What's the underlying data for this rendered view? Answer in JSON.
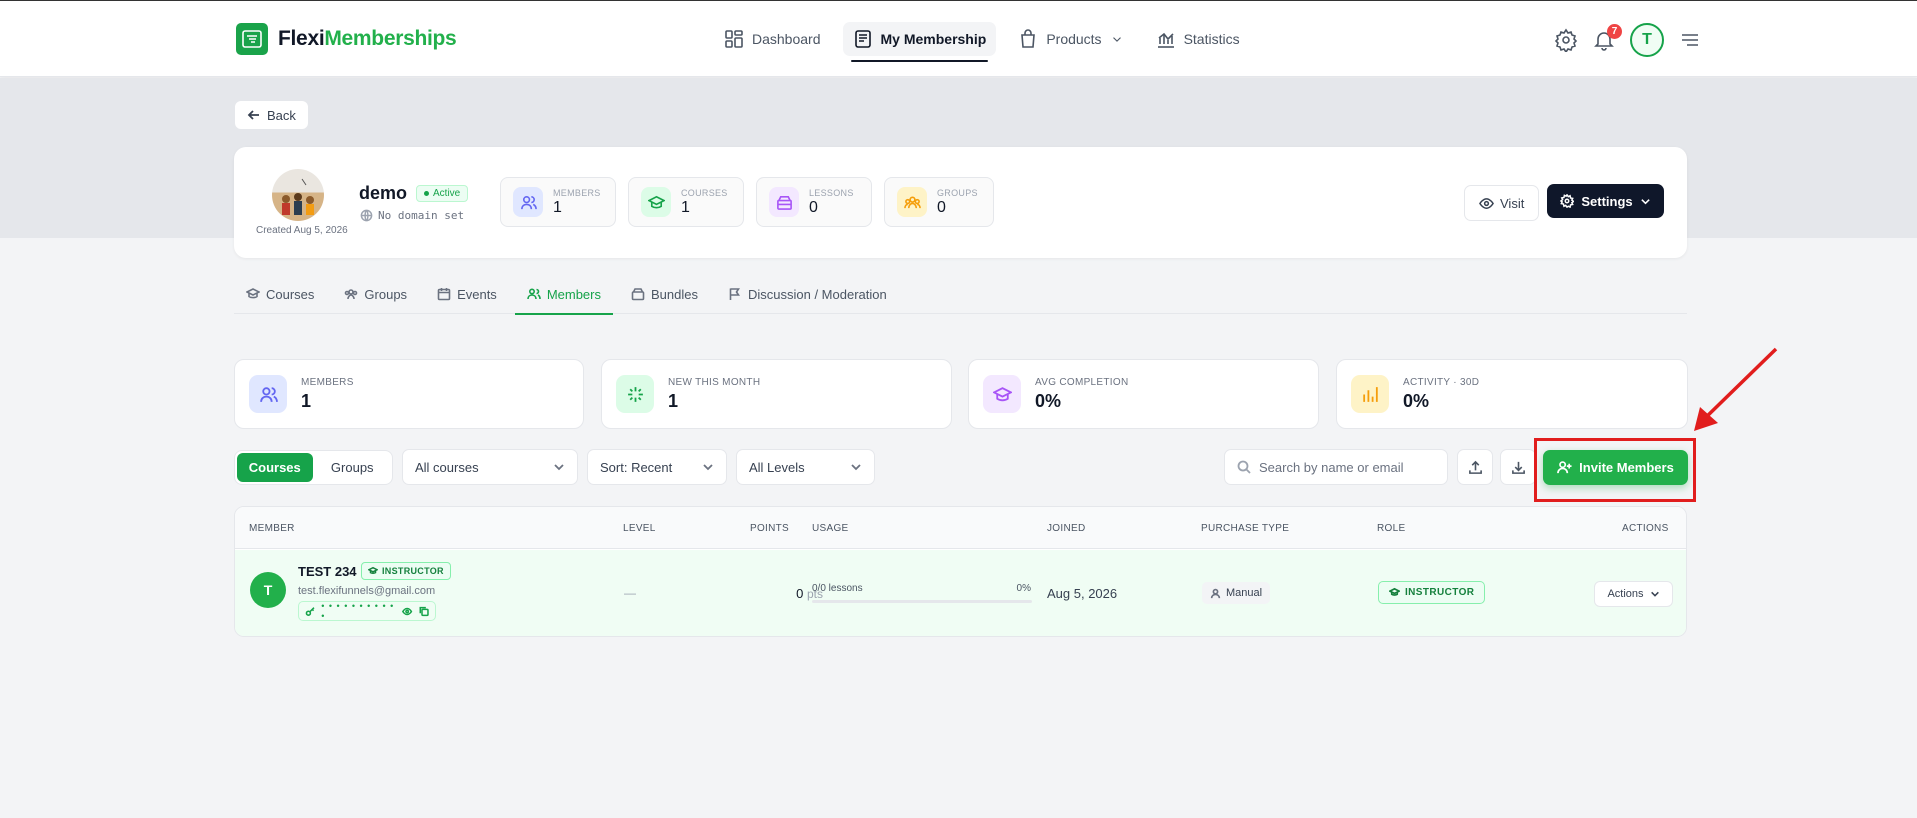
{
  "app": {
    "brand_part1": "Flexi",
    "brand_part2": "Memberships",
    "brand_color": "#22b04b"
  },
  "nav": {
    "items": [
      {
        "label": "Dashboard",
        "icon": "dashboard-icon"
      },
      {
        "label": "My Membership",
        "icon": "membership-icon",
        "active": true
      },
      {
        "label": "Products",
        "icon": "bag-icon"
      },
      {
        "label": "Statistics",
        "icon": "chart-icon"
      }
    ],
    "notifications_count": "7",
    "avatar_initial": "T"
  },
  "back_label": "Back",
  "membership": {
    "name": "demo",
    "status": "Active",
    "domain": "No domain set",
    "created": "Created Aug 5, 2026",
    "stats": [
      {
        "label": "MEMBERS",
        "value": "1",
        "icon": "users-icon"
      },
      {
        "label": "COURSES",
        "value": "1",
        "icon": "graduation-cap-icon"
      },
      {
        "label": "LESSONS",
        "value": "0",
        "icon": "box-icon"
      },
      {
        "label": "GROUPS",
        "value": "0",
        "icon": "group-icon"
      }
    ],
    "visit_label": "Visit",
    "settings_label": "Settings"
  },
  "tabs": [
    {
      "label": "Courses",
      "icon": "graduation-cap-icon"
    },
    {
      "label": "Groups",
      "icon": "group-icon"
    },
    {
      "label": "Events",
      "icon": "calendar-icon"
    },
    {
      "label": "Members",
      "icon": "users-icon",
      "active": true
    },
    {
      "label": "Bundles",
      "icon": "box-icon"
    },
    {
      "label": "Discussion / Moderation",
      "icon": "flag-icon"
    }
  ],
  "kpis": [
    {
      "label": "MEMBERS",
      "value": "1",
      "icon": "users-icon"
    },
    {
      "label": "NEW THIS MONTH",
      "value": "1",
      "icon": "sparkles-icon"
    },
    {
      "label": "AVG COMPLETION",
      "value": "0%",
      "icon": "graduation-cap-icon"
    },
    {
      "label": "ACTIVITY · 30D",
      "value": "0%",
      "icon": "bar-chart-icon"
    }
  ],
  "filters": {
    "segment": [
      "Courses",
      "Groups"
    ],
    "segment_active": "Courses",
    "course_select": "All courses",
    "sort_select": "Sort: Recent",
    "level_select": "All Levels",
    "search_placeholder": "Search by name or email",
    "invite_label": "Invite Members"
  },
  "table": {
    "columns": {
      "member": "MEMBER",
      "level": "LEVEL",
      "points": "POINTS",
      "usage": "USAGE",
      "joined": "JOINED",
      "purchase_type": "PURCHASE TYPE",
      "role": "ROLE",
      "actions": "ACTIONS"
    },
    "rows": [
      {
        "initial": "T",
        "name": "TEST 234",
        "badge": "INSTRUCTOR",
        "email": "test.flexifunnels@gmail.com",
        "password_mask": "• • • • • • • • • • •",
        "level": "—",
        "points": "0",
        "points_unit": "pts",
        "usage_text": "0/0 lessons",
        "usage_pct": "0%",
        "usage_fraction": 0,
        "joined": "Aug 5, 2026",
        "purchase_type": "Manual",
        "role": "INSTRUCTOR",
        "actions_label": "Actions"
      }
    ]
  }
}
